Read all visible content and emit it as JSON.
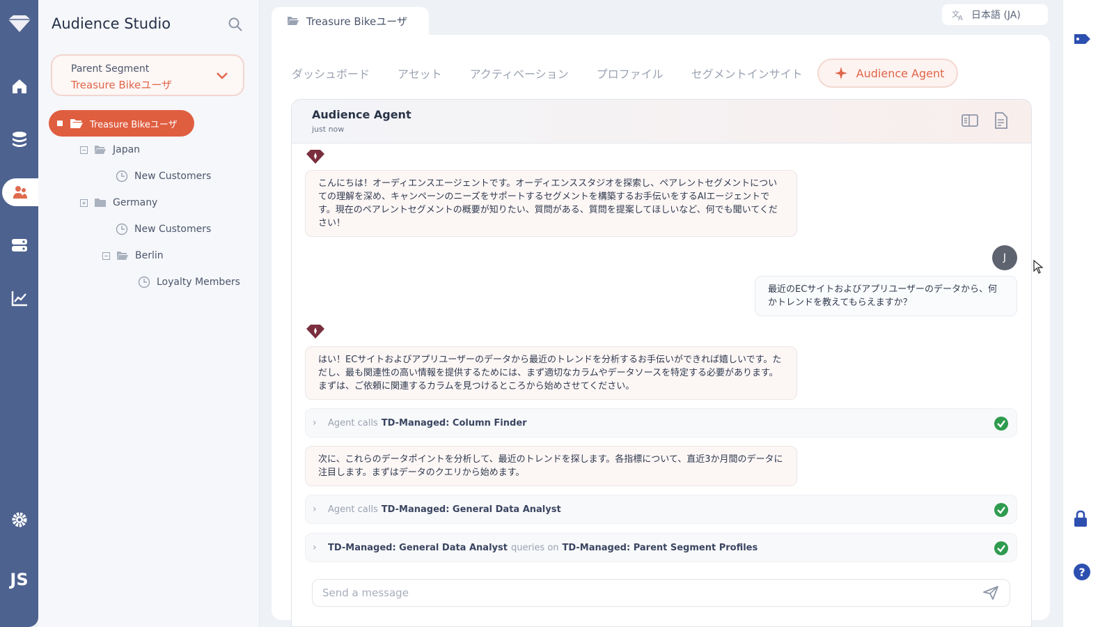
{
  "app": {
    "title": "Audience Studio",
    "user_initials": "JS",
    "rail_icons": [
      "diamond-logo-icon",
      "home-icon",
      "database-icon",
      "audience-icon",
      "server-icon",
      "chart-icon",
      "gear-icon"
    ]
  },
  "sidebar": {
    "parent_segment_label": "Parent Segment",
    "parent_segment_value": "Treasure Bikeユーザ",
    "tree": {
      "root": "Treasure Bikeユーザ",
      "japan": "Japan",
      "japan_child": "New Customers",
      "germany": "Germany",
      "germany_child": "New Customers",
      "berlin": "Berlin",
      "berlin_child": "Loyalty Members"
    }
  },
  "main": {
    "doc_tab": "Treasure Bikeユーザ",
    "language": "日本語 (JA)",
    "tabs": [
      "ダッシュボード",
      "アセット",
      "アクティベーション",
      "プロファイル",
      "セグメントインサイト"
    ],
    "active_tab": "Audience Agent"
  },
  "chat": {
    "title": "Audience Agent",
    "time": "just now",
    "messages": [
      "こんにちは！オーディエンスエージェントです。オーディエンススタジオを探索し、ペアレントセグメントについての理解を深め、キャンペーンのニーズをサポートするセグメントを構築するお手伝いをするAIエージェントです。現在のペアレントセグメントの概要が知りたい、質問がある、質問を提案してほしいなど、何でも聞いてください！",
      "最近のECサイトおよびアプリユーザーのデータから、何かトレンドを教えてもらえますか？",
      "はい！ECサイトおよびアプリユーザーのデータから最近のトレンドを分析するお手伝いができれば嬉しいです。ただし、最も関連性の高い情報を提供するためには、まず適切なカラムやデータソースを特定する必要があります。まずは、ご依頼に関連するカラムを見つけるところから始めさせてください。",
      "次に、これらのデータポイントを分析して、最近のトレンドを探します。各指標について、直近3か月間のデータに注目します。まずはデータのクエリから始めます。"
    ],
    "user_avatar": "J",
    "calls": [
      {
        "prefix": "Agent calls",
        "tool": "TD-Managed: Column Finder"
      },
      {
        "prefix": "Agent calls",
        "tool": "TD-Managed: General Data Analyst"
      },
      {
        "tool": "TD-Managed: General Data Analyst",
        "mid": "queries on",
        "target": "TD-Managed: Parent Segment Profiles"
      }
    ],
    "input_placeholder": "Send a message"
  },
  "colors": {
    "rail": "#4e6290",
    "accent": "#e05e40",
    "success": "#2e9b4e"
  }
}
